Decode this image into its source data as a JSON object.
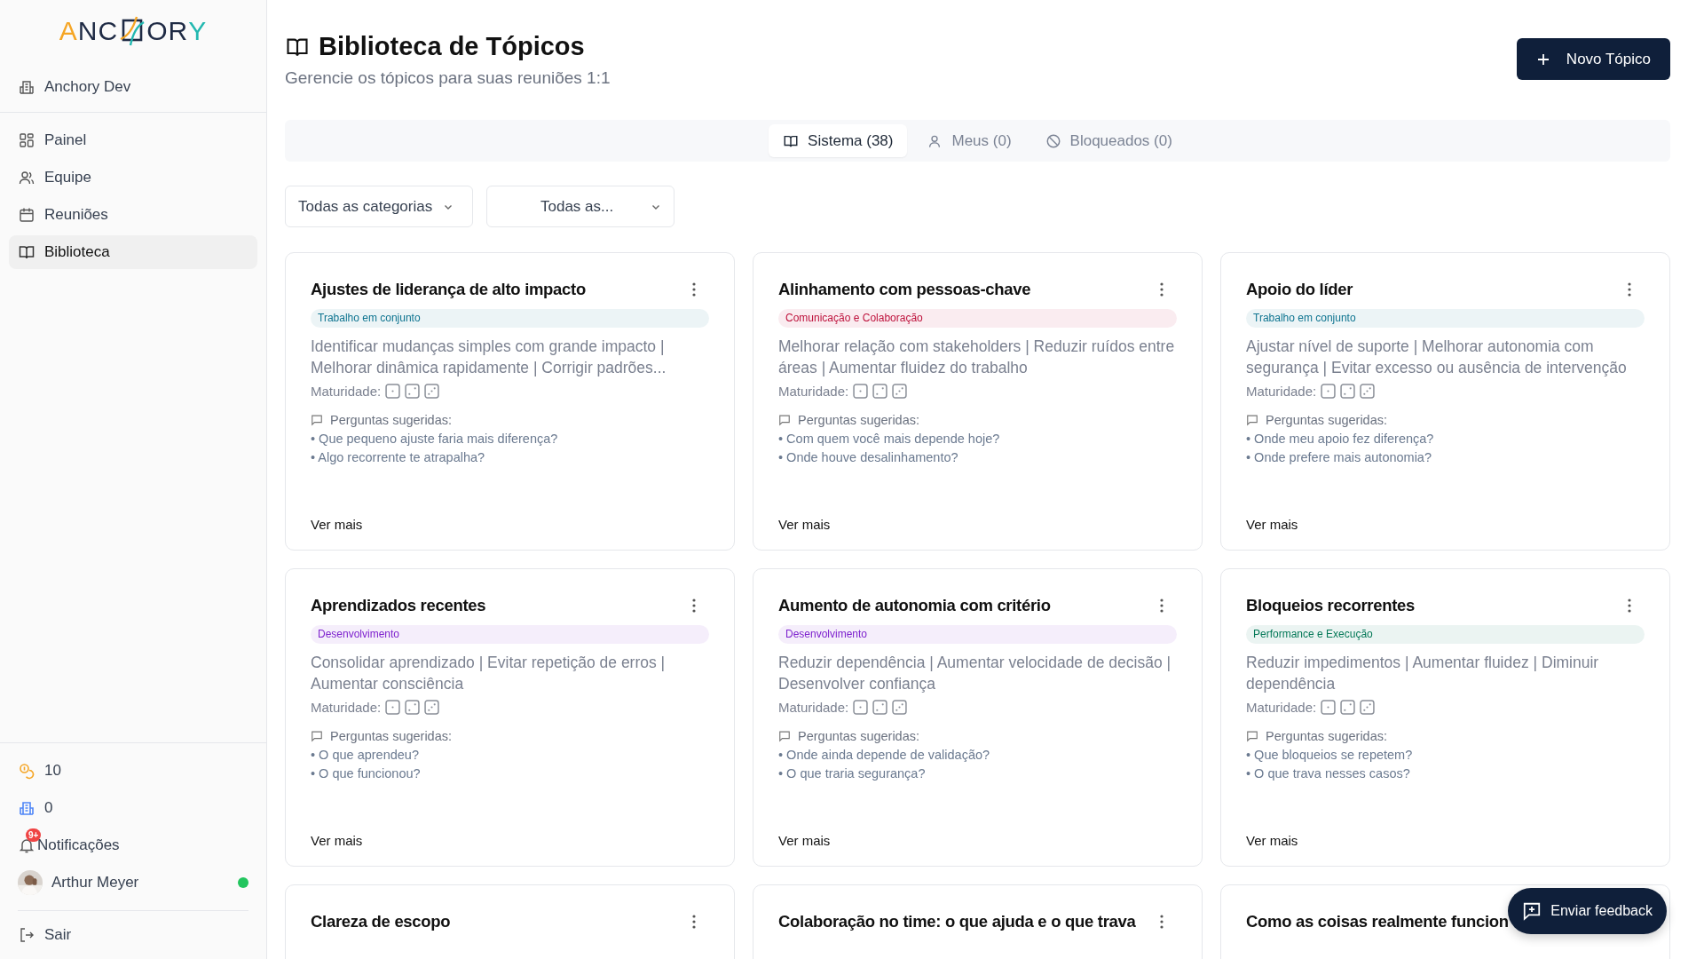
{
  "sidebar": {
    "logo": {
      "start": "ANC",
      "end": "ORY"
    },
    "organization": "Anchory Dev",
    "items": [
      {
        "label": "Painel",
        "selected": false
      },
      {
        "label": "Equipe",
        "selected": false
      },
      {
        "label": "Reuniões",
        "selected": false
      },
      {
        "label": "Biblioteca",
        "selected": true
      }
    ],
    "coins": "10",
    "credits": "0",
    "notifications": {
      "label": "Notificações",
      "badge": "9+"
    },
    "user": {
      "name": "Arthur Meyer",
      "online": true
    },
    "logout": "Sair"
  },
  "header": {
    "title": "Biblioteca de Tópicos",
    "subtitle": "Gerencie os tópicos para suas reuniões 1:1",
    "new_button": "Novo Tópico"
  },
  "tabs": [
    {
      "label": "Sistema (38)",
      "selected": true
    },
    {
      "label": "Meus (0)",
      "selected": false
    },
    {
      "label": "Bloqueados (0)",
      "selected": false
    }
  ],
  "filters": [
    "Todas as categorias",
    "Todas as..."
  ],
  "cards": [
    {
      "title": "Ajustes de liderança de alto impacto",
      "tag": {
        "label": "Trabalho em conjunto",
        "color": "#0e7490"
      },
      "description": "Identificar mudanças simples com grande impacto | Melhorar dinâmica rapidamente | Corrigir padrões...",
      "maturity_label": "Maturidade:",
      "questions_label": "Perguntas sugeridas:",
      "more_label": "Ver mais",
      "questions": [
        "• Que pequeno ajuste faria mais diferença?",
        "• Algo recorrente te atrapalha?"
      ]
    },
    {
      "title": "Alinhamento com pessoas-chave",
      "tag": {
        "label": "Comunicação e Colaboração",
        "color": "#be123c"
      },
      "description": "Melhorar relação com stakeholders | Reduzir ruídos entre áreas | Aumentar fluidez do trabalho",
      "maturity_label": "Maturidade:",
      "questions_label": "Perguntas sugeridas:",
      "more_label": "Ver mais",
      "questions": [
        "• Com quem você mais depende hoje?",
        "• Onde houve desalinhamento?"
      ]
    },
    {
      "title": "Apoio do líder",
      "tag": {
        "label": "Trabalho em conjunto",
        "color": "#0e7490"
      },
      "description": "Ajustar nível de suporte | Melhorar autonomia com segurança | Evitar excesso ou ausência de intervenção",
      "maturity_label": "Maturidade:",
      "questions_label": "Perguntas sugeridas:",
      "more_label": "Ver mais",
      "questions": [
        "• Onde meu apoio fez diferença?",
        "• Onde prefere mais autonomia?"
      ]
    },
    {
      "title": "Aprendizados recentes",
      "tag": {
        "label": "Desenvolvimento",
        "color": "#7e22ce"
      },
      "description": "Consolidar aprendizado | Evitar repetição de erros | Aumentar consciência",
      "maturity_label": "Maturidade:",
      "questions_label": "Perguntas sugeridas:",
      "more_label": "Ver mais",
      "questions": [
        "• O que aprendeu?",
        "• O que funcionou?"
      ]
    },
    {
      "title": "Aumento de autonomia com critério",
      "tag": {
        "label": "Desenvolvimento",
        "color": "#7e22ce"
      },
      "description": "Reduzir dependência | Aumentar velocidade de decisão | Desenvolver confiança",
      "maturity_label": "Maturidade:",
      "questions_label": "Perguntas sugeridas:",
      "more_label": "Ver mais",
      "questions": [
        "• Onde ainda depende de validação?",
        "• O que traria segurança?"
      ]
    },
    {
      "title": "Bloqueios recorrentes",
      "tag": {
        "label": "Performance e Execução",
        "color": "#047857"
      },
      "description": "Reduzir impedimentos | Aumentar fluidez | Diminuir dependência",
      "maturity_label": "Maturidade:",
      "questions_label": "Perguntas sugeridas:",
      "more_label": "Ver mais",
      "questions": [
        "• Que bloqueios se repetem?",
        "• O que trava nesses casos?"
      ]
    },
    {
      "title": "Clareza de escopo"
    },
    {
      "title": "Colaboração no time: o que ajuda e o que trava"
    },
    {
      "title": "Como as coisas realmente funcion"
    }
  ],
  "feedback_button": "Enviar feedback"
}
